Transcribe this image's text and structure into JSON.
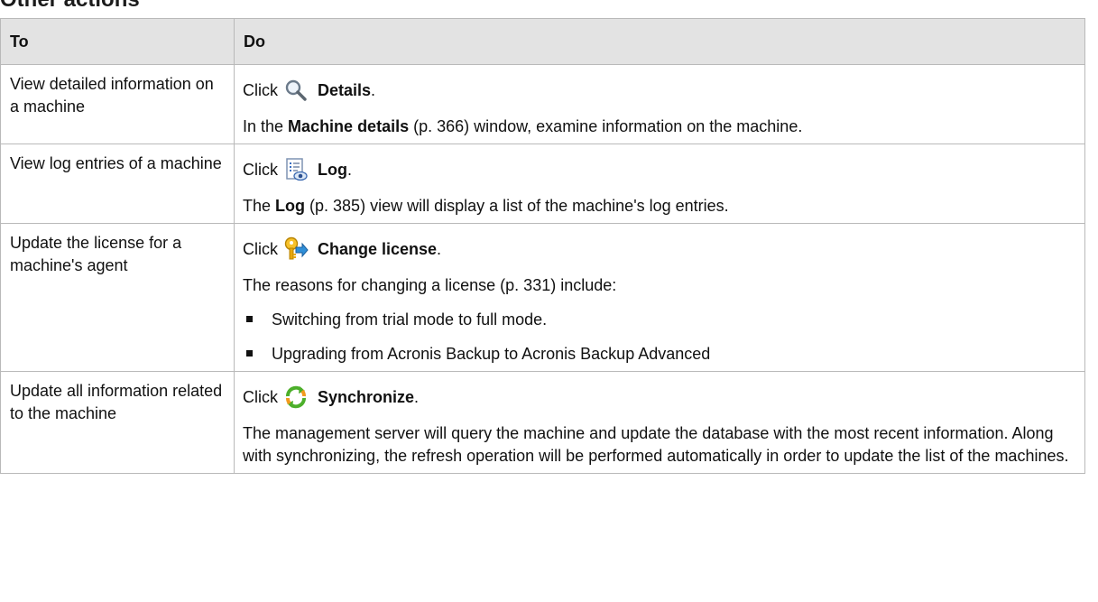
{
  "page": {
    "heading": "Other actions"
  },
  "table": {
    "headers": {
      "to": "To",
      "do": "Do"
    },
    "rows": [
      {
        "to": "View detailed information on a machine",
        "click_prefix": "Click",
        "icon": "magnifier-icon",
        "action": "Details",
        "action_suffix": ".",
        "desc_pre": "In the ",
        "desc_bold": "Machine details",
        "desc_post": " (p. 366) window, examine information on the machine."
      },
      {
        "to": "View log entries of a machine",
        "click_prefix": "Click",
        "icon": "log-icon",
        "action": "Log",
        "action_suffix": ".",
        "desc_pre": "The ",
        "desc_bold": "Log",
        "desc_post": " (p. 385) view will display a list of the machine's log entries."
      },
      {
        "to": "Update the license for a machine's agent",
        "click_prefix": "Click",
        "icon": "key-license-icon",
        "action": "Change license",
        "action_suffix": ".",
        "desc": "The reasons for changing a license (p. 331) include:",
        "bullets": [
          "Switching from trial mode to full mode.",
          "Upgrading from Acronis Backup to Acronis Backup Advanced"
        ]
      },
      {
        "to": "Update all information related to the machine",
        "click_prefix": "Click",
        "icon": "synchronize-icon",
        "action": "Synchronize",
        "action_suffix": ".",
        "desc": "The management server will query the machine and update the database with the most recent information. Along with synchronizing, the refresh operation will be performed automatically in order to update the list of the machines."
      }
    ]
  },
  "colors": {
    "header_bg": "#e3e3e3",
    "border": "#b9b9b9",
    "sync_green": "#4caf2a",
    "sync_orange": "#f29a1d"
  }
}
